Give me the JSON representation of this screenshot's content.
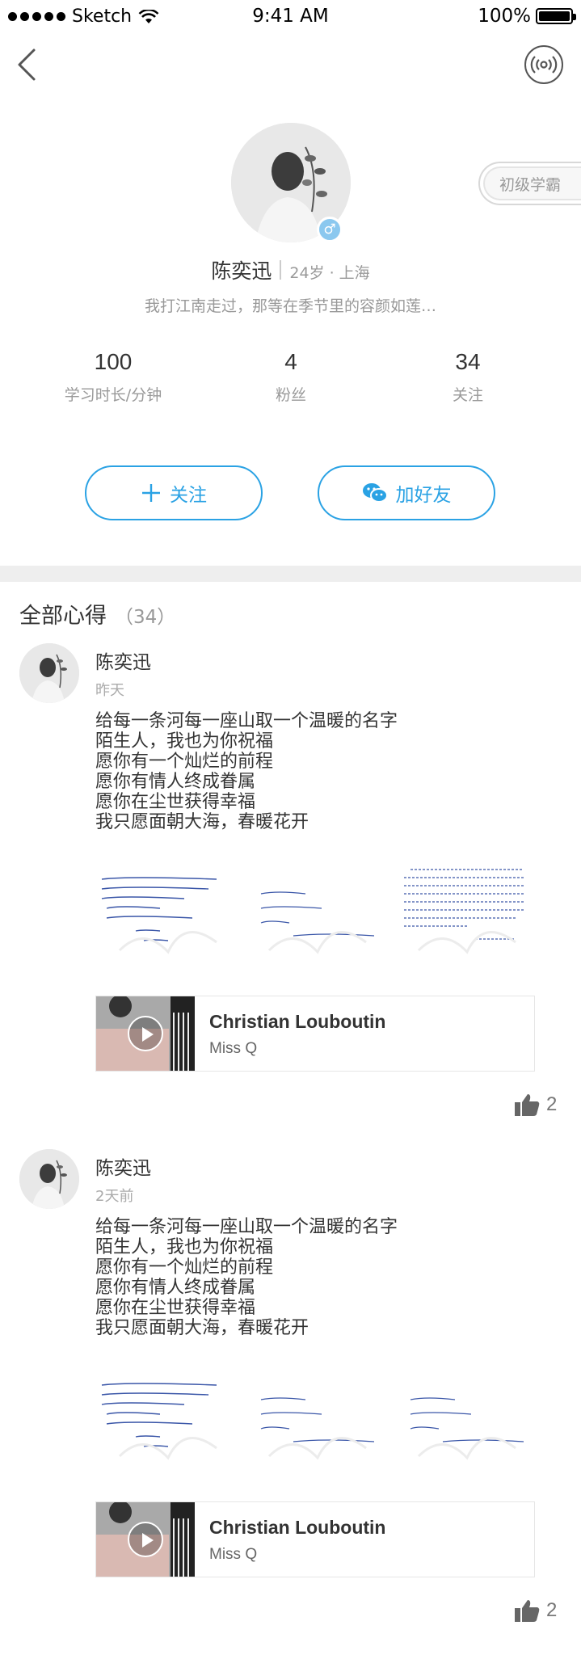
{
  "status_bar": {
    "carrier": "Sketch",
    "time": "9:41 AM",
    "battery": "100%"
  },
  "nav": {
    "back_icon": "chevron-left-icon",
    "radio_icon": "broadcast-icon"
  },
  "profile": {
    "name": "陈奕迅",
    "meta": "24岁 · 上海",
    "signature": "我打江南走过，那等在季节里的容颜如莲…",
    "gender_icon": "male-icon",
    "level_badge": "初级学霸",
    "stats": [
      {
        "value": "100",
        "label": "学习时长/分钟"
      },
      {
        "value": "4",
        "label": "粉丝"
      },
      {
        "value": "34",
        "label": "关注"
      }
    ],
    "follow_label": "关注",
    "add_friend_label": "加好友"
  },
  "section": {
    "title": "全部心得",
    "count": "（34）"
  },
  "posts": [
    {
      "author": "陈奕迅",
      "time": "昨天",
      "lines": [
        "给每一条河每一座山取一个温暖的名字",
        "陌生人，我也为你祝福",
        "愿你有一个灿烂的前程",
        "愿你有情人终成眷属",
        "愿你在尘世获得幸福",
        "我只愿面朝大海，春暖花开"
      ],
      "music": {
        "title": "Christian Louboutin",
        "artist": "Miss Q"
      },
      "likes": "2"
    },
    {
      "author": "陈奕迅",
      "time": "2天前",
      "lines": [
        "给每一条河每一座山取一个温暖的名字",
        "陌生人，我也为你祝福",
        "愿你有一个灿烂的前程",
        "愿你有情人终成眷属",
        "愿你在尘世获得幸福",
        "我只愿面朝大海，春暖花开"
      ],
      "music": {
        "title": "Christian Louboutin",
        "artist": "Miss Q"
      },
      "likes": "2"
    }
  ],
  "colors": {
    "accent": "#2aa2e4",
    "gender_badge": "#8bc8ef",
    "divider": "#eeeeee"
  }
}
